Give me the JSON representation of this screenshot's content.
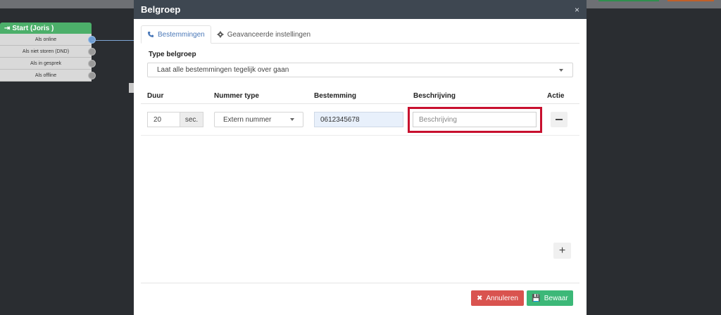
{
  "background": {
    "node": {
      "title": "Start (Joris )",
      "rows": [
        "Als online",
        "Als niet storen (DND)",
        "Als in gesprek",
        "Als offline"
      ]
    }
  },
  "modal": {
    "title": "Belgroep",
    "close_icon": "×",
    "tabs": [
      {
        "label": "Bestemmingen",
        "icon": "phone-icon",
        "active": true
      },
      {
        "label": "Geavanceerde instellingen",
        "icon": "gear-icon",
        "active": false
      }
    ],
    "type_label": "Type belgroep",
    "type_value": "Laat alle bestemmingen tegelijk over gaan",
    "table": {
      "headers": [
        "Duur",
        "Nummer type",
        "Bestemming",
        "Beschrijving",
        "Actie"
      ],
      "row": {
        "duration": "20",
        "duration_unit": "sec.",
        "number_type": "Extern nummer",
        "destination": "0612345678",
        "description_placeholder": "Beschrijving"
      }
    },
    "buttons": {
      "cancel": "Annuleren",
      "save": "Bewaar"
    }
  },
  "colors": {
    "header": "#3e4751",
    "accent": "#4a78b8",
    "highlight": "#c8102e",
    "cancel": "#d9534f",
    "save": "#3cb878"
  }
}
